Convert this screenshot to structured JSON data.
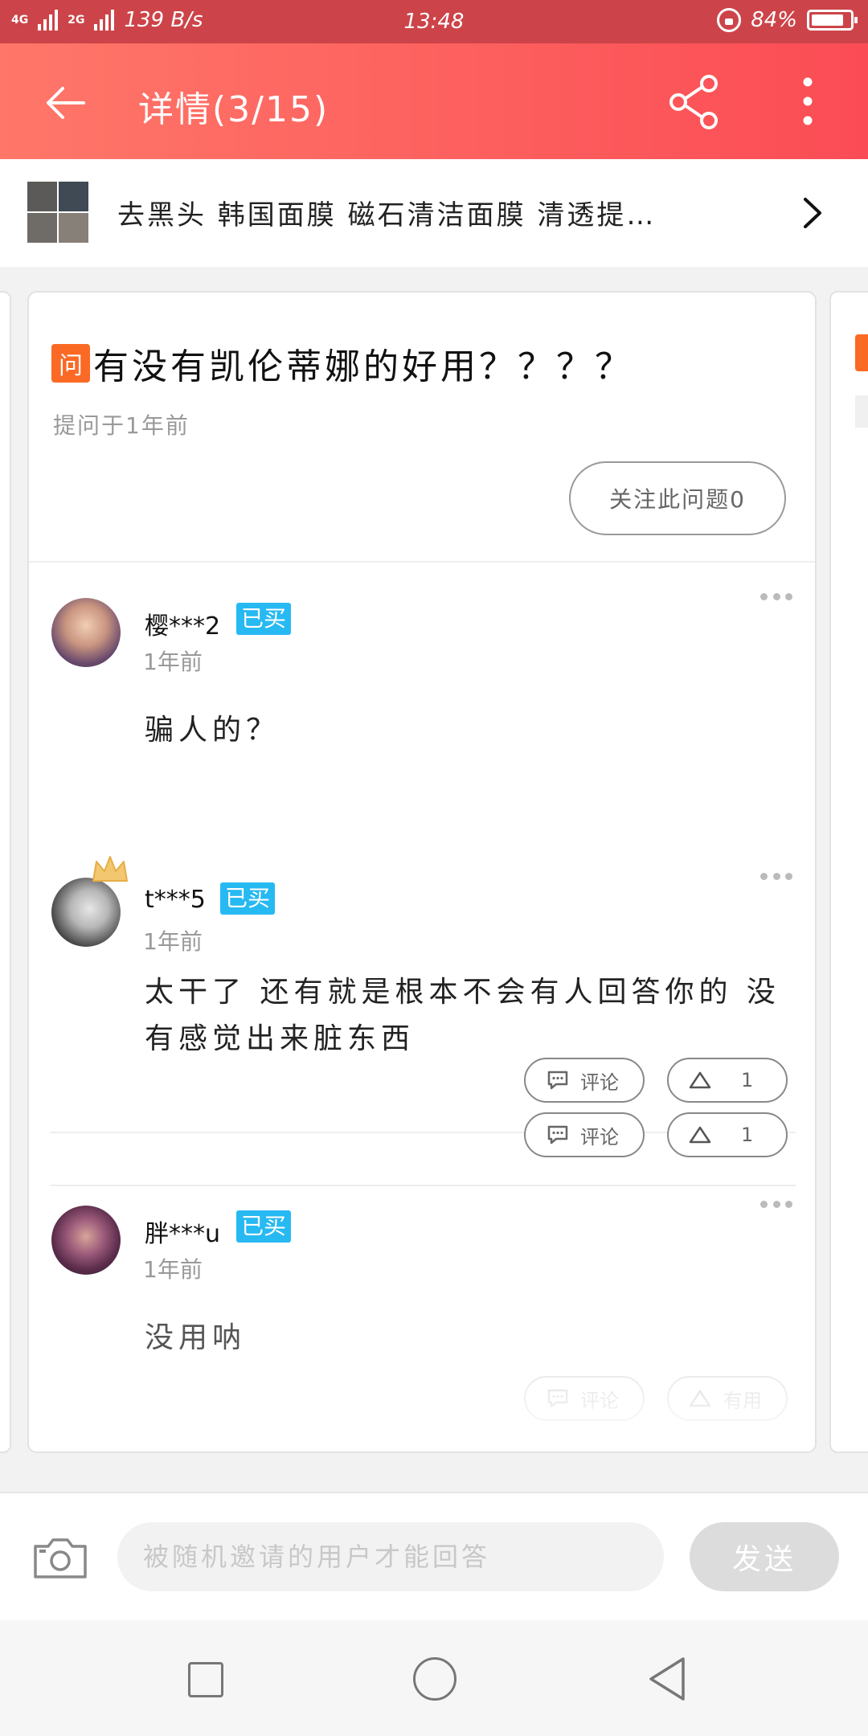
{
  "status_bar": {
    "network_1": "4G",
    "network_2": "2G",
    "speed": "139 B/s",
    "time": "13:48",
    "battery_text": "84%",
    "battery_level": 0.84
  },
  "header": {
    "title": "详情(3/15)"
  },
  "product": {
    "title": "去黑头 韩国面膜 磁石清洁面膜 清透提…"
  },
  "question": {
    "badge": "问",
    "title": "有没有凯伦蒂娜的好用？？？？",
    "meta": "提问于1年前",
    "follow_label": "关注此问题0"
  },
  "answers": [
    {
      "name": "樱***2",
      "badge": "已买",
      "time": "1年前",
      "text": "骗人的？",
      "comment_label": "评论",
      "like_count": "1"
    },
    {
      "name": "t***5",
      "badge": "已买",
      "time": "1年前",
      "text": "太干了 还有就是根本不会有人回答你的 没有感觉出来脏东西",
      "comment_label": "评论",
      "like_count": "1"
    },
    {
      "name": "胖***u",
      "badge": "已买",
      "time": "1年前",
      "text": "没用呐",
      "comment_label": "评论",
      "like_label": "有用"
    }
  ],
  "reply": {
    "placeholder": "被随机邀请的用户才能回答",
    "send_label": "发送"
  },
  "colors": {
    "header_start": "#ff7769",
    "header_end": "#fb4c55",
    "status_bar": "#cc4449",
    "badge_orange": "#fb6a25",
    "badge_blue": "#27b9f2"
  },
  "icons": [
    "back-arrow-icon",
    "share-icon",
    "more-vertical-icon",
    "chevron-right-icon",
    "more-horizontal-icon",
    "comment-icon",
    "like-triangle-icon",
    "camera-icon",
    "crown-icon",
    "nav-recent-icon",
    "nav-home-icon",
    "nav-back-icon"
  ]
}
